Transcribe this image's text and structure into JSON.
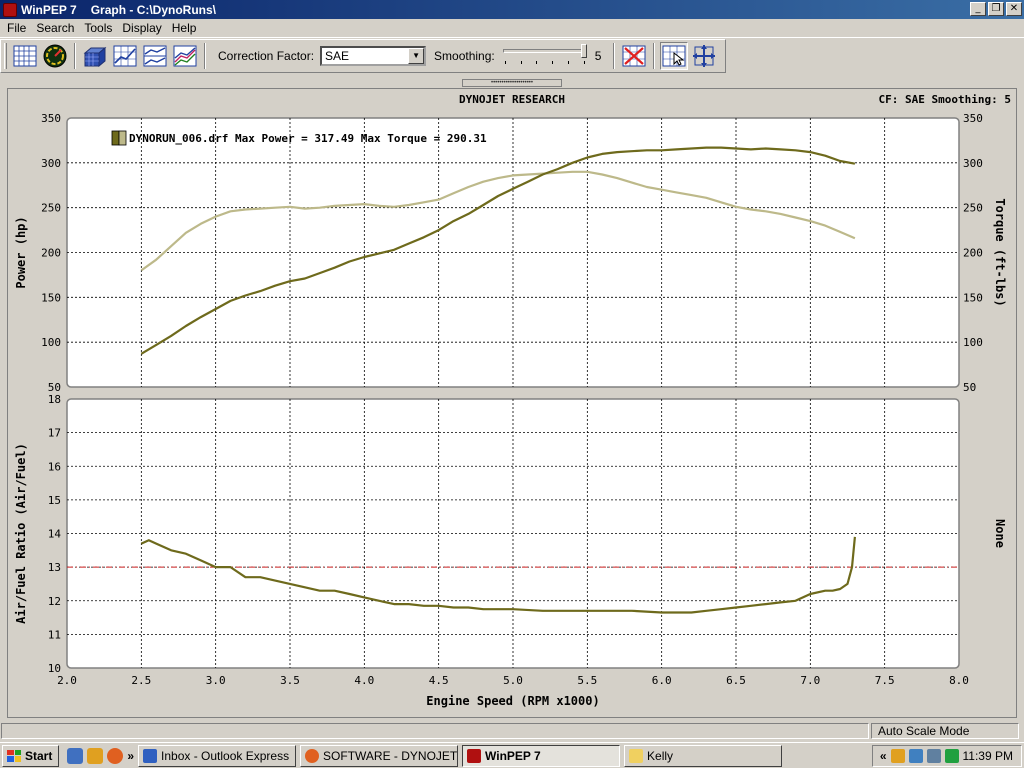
{
  "window": {
    "app_name": "WinPEP 7",
    "title": "Graph - C:\\DynoRuns\\"
  },
  "menu": [
    "File",
    "Search",
    "Tools",
    "Display",
    "Help"
  ],
  "toolbar": {
    "correction_label": "Correction Factor:",
    "correction_value": "SAE",
    "smoothing_label": "Smoothing:",
    "smoothing_value": "5",
    "smoothing_level": 5,
    "smoothing_max": 5
  },
  "graph": {
    "header": "DYNOJET RESEARCH",
    "cf_info": "CF: SAE  Smoothing: 5",
    "legend": "DYNORUN_006.drf Max Power = 317.49 Max Torque = 290.31",
    "right_label_bottom": "None"
  },
  "statusbar": {
    "mode": "Auto Scale Mode"
  },
  "taskbar": {
    "start": "Start",
    "tasks": [
      {
        "label": "Inbox - Outlook Express",
        "active": false
      },
      {
        "label": "SOFTWARE - DYNOJET....",
        "active": false
      },
      {
        "label": "WinPEP 7",
        "active": true
      },
      {
        "label": "Kelly",
        "active": false
      }
    ],
    "clock": "11:39 PM"
  },
  "colors": {
    "power": "#6e6a1c",
    "torque": "#bdb98a",
    "afr": "#6e6a1c",
    "afr_target": "#cc2020"
  },
  "chart_data": [
    {
      "type": "line",
      "xlabel": "",
      "ylabel": "Power (hp)",
      "y2label": "Torque (ft-lbs)",
      "xlim": [
        2.0,
        8.0
      ],
      "ylim": [
        50,
        350
      ],
      "y2lim": [
        50,
        350
      ],
      "yticks": [
        50,
        100,
        150,
        200,
        250,
        300,
        350
      ],
      "grid": true,
      "legend_position": "top-left",
      "series": [
        {
          "name": "DYNORUN_006.drf",
          "role": "power",
          "x": [
            2.5,
            2.6,
            2.7,
            2.8,
            2.9,
            3.0,
            3.1,
            3.2,
            3.3,
            3.4,
            3.5,
            3.6,
            3.7,
            3.8,
            3.9,
            4.0,
            4.1,
            4.2,
            4.3,
            4.4,
            4.5,
            4.6,
            4.7,
            4.8,
            4.9,
            5.0,
            5.1,
            5.2,
            5.3,
            5.4,
            5.5,
            5.6,
            5.7,
            5.8,
            5.9,
            6.0,
            6.1,
            6.2,
            6.3,
            6.4,
            6.5,
            6.6,
            6.7,
            6.8,
            6.9,
            7.0,
            7.1,
            7.2,
            7.3
          ],
          "y": [
            87,
            97,
            107,
            118,
            128,
            137,
            146,
            152,
            157,
            163,
            168,
            171,
            177,
            183,
            190,
            195,
            199,
            203,
            210,
            217,
            225,
            235,
            243,
            253,
            263,
            271,
            279,
            287,
            293,
            300,
            306,
            310,
            312,
            313,
            314,
            314,
            315,
            316,
            317,
            317,
            316,
            315,
            316,
            315,
            314,
            312,
            308,
            302,
            299
          ]
        },
        {
          "name": "DYNORUN_006.drf",
          "role": "torque",
          "x": [
            2.5,
            2.6,
            2.7,
            2.8,
            2.9,
            3.0,
            3.1,
            3.2,
            3.3,
            3.4,
            3.5,
            3.6,
            3.7,
            3.8,
            3.9,
            4.0,
            4.1,
            4.2,
            4.3,
            4.4,
            4.5,
            4.6,
            4.7,
            4.8,
            4.9,
            5.0,
            5.1,
            5.2,
            5.3,
            5.4,
            5.5,
            5.6,
            5.7,
            5.8,
            5.9,
            6.0,
            6.1,
            6.2,
            6.3,
            6.4,
            6.5,
            6.6,
            6.7,
            6.8,
            6.9,
            7.0,
            7.1,
            7.2,
            7.3
          ],
          "y": [
            180,
            192,
            207,
            222,
            232,
            240,
            246,
            248,
            249,
            250,
            251,
            249,
            250,
            252,
            253,
            254,
            252,
            251,
            253,
            256,
            259,
            266,
            273,
            279,
            283,
            286,
            287,
            288,
            289,
            290,
            290,
            287,
            283,
            278,
            273,
            270,
            267,
            264,
            261,
            256,
            251,
            248,
            246,
            243,
            239,
            235,
            230,
            223,
            216
          ]
        }
      ]
    },
    {
      "type": "line",
      "xlabel": "Engine Speed (RPM x1000)",
      "ylabel": "Air/Fuel Ratio (Air/Fuel)",
      "xlim": [
        2.0,
        8.0
      ],
      "ylim": [
        10,
        18
      ],
      "xticks": [
        2.0,
        2.5,
        3.0,
        3.5,
        4.0,
        4.5,
        5.0,
        5.5,
        6.0,
        6.5,
        7.0,
        7.5,
        8.0
      ],
      "yticks": [
        10,
        11,
        12,
        13,
        14,
        15,
        16,
        17,
        18
      ],
      "grid": true,
      "reference_line": 13,
      "series": [
        {
          "role": "afr",
          "x": [
            2.5,
            2.55,
            2.6,
            2.7,
            2.8,
            2.9,
            3.0,
            3.1,
            3.2,
            3.3,
            3.4,
            3.5,
            3.6,
            3.7,
            3.8,
            3.9,
            4.0,
            4.1,
            4.2,
            4.3,
            4.4,
            4.5,
            4.6,
            4.7,
            4.8,
            4.9,
            5.0,
            5.2,
            5.4,
            5.6,
            5.8,
            6.0,
            6.1,
            6.2,
            6.3,
            6.4,
            6.5,
            6.6,
            6.7,
            6.8,
            6.9,
            7.0,
            7.1,
            7.15,
            7.2,
            7.25,
            7.28,
            7.3
          ],
          "y": [
            13.7,
            13.8,
            13.7,
            13.5,
            13.4,
            13.2,
            13.0,
            13.0,
            12.7,
            12.7,
            12.6,
            12.5,
            12.4,
            12.3,
            12.3,
            12.2,
            12.1,
            12.0,
            11.9,
            11.9,
            11.85,
            11.85,
            11.8,
            11.8,
            11.75,
            11.75,
            11.75,
            11.7,
            11.7,
            11.7,
            11.7,
            11.65,
            11.65,
            11.65,
            11.7,
            11.75,
            11.8,
            11.85,
            11.9,
            11.95,
            12.0,
            12.2,
            12.3,
            12.3,
            12.35,
            12.5,
            13.0,
            13.9
          ]
        }
      ]
    }
  ]
}
